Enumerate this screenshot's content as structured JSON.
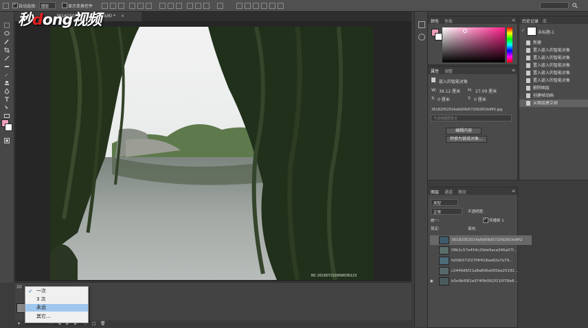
{
  "app": {
    "logo_text_pre": "秒",
    "logo_text_o": "d",
    "logo_text_post": "ong视频",
    "doc_tab_1": "3616250",
    "doc_tab_2": "fe9ff2, RGB/8) *",
    "doc_tab_close": "×"
  },
  "options_bar": {
    "auto_select_label": "自动选择:",
    "auto_select_value": "图层",
    "transform_label": "显示变换控件"
  },
  "color_panel": {
    "tab_color": "颜色",
    "tab_swatches": "色板",
    "fg_color": "#f2a0c0",
    "bg_color": "#ffffff",
    "hue_color": "#ff1f8a"
  },
  "properties_panel": {
    "tab_properties": "属性",
    "tab_adjust": "调整",
    "title": "嵌入的智能对象",
    "w_label": "W:",
    "w_value": "36.12 厘米",
    "h_label": "H:",
    "h_value": "27.09 厘米",
    "x_label": "X:",
    "x_value": "0 厘米",
    "y_label": "Y:",
    "y_value": "0 厘米",
    "file_name": "36182052014a9d09d57209281fe9ff2.jpg",
    "comp_placeholder": "不适用图层复合",
    "edit_btn": "编辑内容",
    "convert_btn": "转换为链接对象..."
  },
  "history_panel": {
    "tab_history": "历史记录",
    "tab_other": "库",
    "snapshot": "未标题-1",
    "items": [
      "新建",
      "置入嵌入的智能对象",
      "置入嵌入的智能对象",
      "置入嵌入的智能对象",
      "置入嵌入的智能对象",
      "置入嵌入的智能对象",
      "删除图层",
      "创建帧动画",
      "从图层建立帧"
    ]
  },
  "layers_panel": {
    "tab_layers": "图层",
    "tab_channels": "通道",
    "tab_paths": "路径",
    "kind": "类型",
    "mode": "正常",
    "opacity_label": "不透明度:",
    "unify_label": "统一:",
    "propagate_label": "传播帧 1",
    "lock_label": "锁定:",
    "fill_label": "填充:",
    "layers": [
      "36182052014a9d09d57209281fe9ff2",
      "08b1c57e454c29da5aca346a07f...",
      "fa59b572f27f4f418ae82e7a79...",
      "c2449d6f21a8a806a065ba25192...",
      "b5e9bf081e974f9d562f110f78e8..."
    ]
  },
  "photo": {
    "watermark": "NC-201607210958036123"
  },
  "timeline": {
    "frame_time": "10",
    "menu": {
      "items": [
        "一次",
        "3 次",
        "永远",
        "其它..."
      ],
      "checked_index": 0,
      "highlight_index": 2
    }
  }
}
